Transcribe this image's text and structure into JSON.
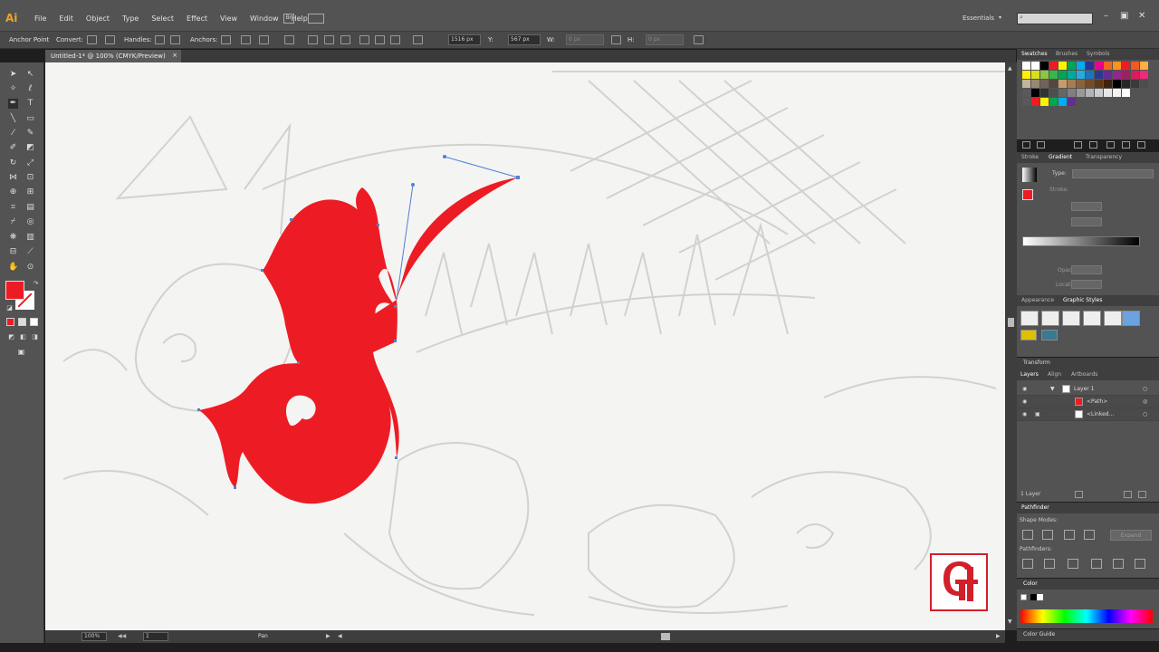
{
  "app": {
    "logo": "Ai",
    "menu": [
      "File",
      "Edit",
      "Object",
      "Type",
      "Select",
      "Effect",
      "View",
      "Window",
      "Help"
    ],
    "bridge_label": "Br",
    "workspace": "Essentials",
    "window_controls": [
      "–",
      "▣",
      "✕"
    ]
  },
  "control_bar": {
    "anchor_point": "Anchor Point",
    "convert": "Convert:",
    "handles": "Handles:",
    "anchors": "Anchors:",
    "x_value": "1516 px",
    "y_label": "Y:",
    "y_value": "567 px",
    "w_label": "W:",
    "w_value": "0 px",
    "h_label": "H:",
    "h_value": "0 px"
  },
  "document_tab": {
    "title": "Untitled-1* @ 100% (CMYK/Preview)",
    "close": "×"
  },
  "status": {
    "zoom": "100%",
    "artboard": "1",
    "tool": "Pan"
  },
  "panels": {
    "swatches_tabs": [
      "Swatches",
      "Brushes",
      "Symbols"
    ],
    "stroke_tabs": [
      "Stroke",
      "Gradient",
      "Transparency"
    ],
    "gradient_type_label": "Type:",
    "stroke_label": "Stroke:",
    "opacity_label": "Opacity:",
    "location_label": "Location:",
    "appearance_tabs": [
      "Appearance",
      "Graphic Styles"
    ],
    "transform_label": "Transform",
    "layers_tabs": [
      "Layers",
      "Align",
      "Artboards"
    ],
    "layers": [
      {
        "name": "Layer 1"
      },
      {
        "name": "<Path>"
      },
      {
        "name": "<Linked..."
      }
    ],
    "layers_count": "1 Layer",
    "pathfinder_label": "Pathfinder",
    "shape_modes_label": "Shape Modes:",
    "expand_label": "Expand",
    "pathfinders_label": "Pathfinders:",
    "color_label": "Color",
    "color_guide_label": "Color Guide"
  },
  "colors": {
    "fill": "#ed1c24",
    "accent": "#d31f2a",
    "ui_dark": "#535353"
  }
}
